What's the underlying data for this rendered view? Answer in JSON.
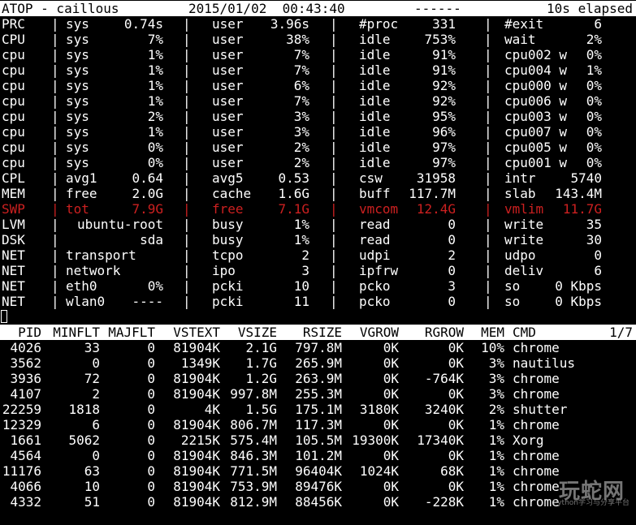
{
  "header": {
    "title": "ATOP - caillous",
    "datetime": "2015/01/02  00:43:40",
    "dashes": "------",
    "elapsed": "10s elapsed"
  },
  "system_rows": [
    {
      "label": "PRC",
      "c1k": "sys",
      "c1v": "0.74s",
      "c2k": "user",
      "c2v": "3.96s",
      "c3k": "#proc",
      "c3v": "331",
      "c4k": "#exit",
      "c4v": "6"
    },
    {
      "label": "CPU",
      "c1k": "sys",
      "c1v": "7%",
      "c2k": "user",
      "c2v": "38%",
      "c3k": "idle",
      "c3v": "753%",
      "c4k": "wait",
      "c4v": "2%"
    },
    {
      "label": "cpu",
      "c1k": "sys",
      "c1v": "1%",
      "c2k": "user",
      "c2v": "7%",
      "c3k": "idle",
      "c3v": "91%",
      "c4k": "cpu002 w",
      "c4v": "0%"
    },
    {
      "label": "cpu",
      "c1k": "sys",
      "c1v": "1%",
      "c2k": "user",
      "c2v": "7%",
      "c3k": "idle",
      "c3v": "91%",
      "c4k": "cpu004 w",
      "c4v": "1%"
    },
    {
      "label": "cpu",
      "c1k": "sys",
      "c1v": "1%",
      "c2k": "user",
      "c2v": "6%",
      "c3k": "idle",
      "c3v": "92%",
      "c4k": "cpu000 w",
      "c4v": "0%"
    },
    {
      "label": "cpu",
      "c1k": "sys",
      "c1v": "1%",
      "c2k": "user",
      "c2v": "7%",
      "c3k": "idle",
      "c3v": "92%",
      "c4k": "cpu006 w",
      "c4v": "0%"
    },
    {
      "label": "cpu",
      "c1k": "sys",
      "c1v": "2%",
      "c2k": "user",
      "c2v": "3%",
      "c3k": "idle",
      "c3v": "95%",
      "c4k": "cpu003 w",
      "c4v": "0%"
    },
    {
      "label": "cpu",
      "c1k": "sys",
      "c1v": "1%",
      "c2k": "user",
      "c2v": "3%",
      "c3k": "idle",
      "c3v": "96%",
      "c4k": "cpu007 w",
      "c4v": "0%"
    },
    {
      "label": "cpu",
      "c1k": "sys",
      "c1v": "0%",
      "c2k": "user",
      "c2v": "2%",
      "c3k": "idle",
      "c3v": "97%",
      "c4k": "cpu005 w",
      "c4v": "0%"
    },
    {
      "label": "cpu",
      "c1k": "sys",
      "c1v": "0%",
      "c2k": "user",
      "c2v": "2%",
      "c3k": "idle",
      "c3v": "97%",
      "c4k": "cpu001 w",
      "c4v": "0%"
    },
    {
      "label": "CPL",
      "c1k": "avg1",
      "c1v": "0.64",
      "c2k": "avg5",
      "c2v": "0.53",
      "c3k": "csw",
      "c3v": "31958",
      "c4k": "intr",
      "c4v": "5740"
    },
    {
      "label": "MEM",
      "c1k": "free",
      "c1v": "2.0G",
      "c2k": "cache",
      "c2v": "1.6G",
      "c3k": "buff",
      "c3v": "117.7M",
      "c4k": "slab",
      "c4v": "143.4M"
    },
    {
      "label": "SWP",
      "c1k": "tot",
      "c1v": "7.9G",
      "c2k": "free",
      "c2v": "7.1G",
      "c3k": "vmcom",
      "c3v": "12.4G",
      "c4k": "vmlim",
      "c4v": "11.7G"
    },
    {
      "label": "LVM",
      "c1k": "",
      "c1v": "ubuntu-root",
      "c2k": "busy",
      "c2v": "1%",
      "c3k": "read",
      "c3v": "0",
      "c4k": "write",
      "c4v": "35"
    },
    {
      "label": "DSK",
      "c1k": "",
      "c1v": "sda",
      "c2k": "busy",
      "c2v": "1%",
      "c3k": "read",
      "c3v": "0",
      "c4k": "write",
      "c4v": "30"
    },
    {
      "label": "NET",
      "c1k": "transport",
      "c1v": "",
      "c2k": "tcpo",
      "c2v": "2",
      "c3k": "udpi",
      "c3v": "2",
      "c4k": "udpo",
      "c4v": "0"
    },
    {
      "label": "NET",
      "c1k": "network",
      "c1v": "",
      "c2k": "ipo",
      "c2v": "3",
      "c3k": "ipfrw",
      "c3v": "0",
      "c4k": "deliv",
      "c4v": "6"
    },
    {
      "label": "NET",
      "c1k": "eth0",
      "c1v": "0%",
      "c2k": "pcki",
      "c2v": "10",
      "c3k": "pcko",
      "c3v": "3",
      "c4k": "so",
      "c4v": "0 Kbps"
    },
    {
      "label": "NET",
      "c1k": "wlan0",
      "c1v": "----",
      "c2k": "pcki",
      "c2v": "11",
      "c3k": "pcko",
      "c3v": "0",
      "c4k": "so",
      "c4v": "0 Kbps"
    }
  ],
  "separator": "|",
  "process_header": {
    "pid": "PID",
    "minflt": "MINFLT",
    "majflt": "MAJFLT",
    "vstext": "VSTEXT",
    "vsize": "VSIZE",
    "rsize": "RSIZE",
    "vgrow": "VGROW",
    "rgrow": "RGROW",
    "mem": "MEM",
    "cmd": "CMD",
    "page": "1/7"
  },
  "processes": [
    {
      "pid": "4026",
      "minflt": "33",
      "majflt": "0",
      "vstext": "81904K",
      "vsize": "2.1G",
      "rsize": "797.8M",
      "vgrow": "0K",
      "rgrow": "0K",
      "mem": "10%",
      "cmd": "chrome"
    },
    {
      "pid": "3562",
      "minflt": "0",
      "majflt": "0",
      "vstext": "1349K",
      "vsize": "1.7G",
      "rsize": "265.9M",
      "vgrow": "0K",
      "rgrow": "0K",
      "mem": "3%",
      "cmd": "nautilus"
    },
    {
      "pid": "3936",
      "minflt": "72",
      "majflt": "0",
      "vstext": "81904K",
      "vsize": "1.2G",
      "rsize": "263.9M",
      "vgrow": "0K",
      "rgrow": "-764K",
      "mem": "3%",
      "cmd": "chrome"
    },
    {
      "pid": "4107",
      "minflt": "2",
      "majflt": "0",
      "vstext": "81904K",
      "vsize": "997.8M",
      "rsize": "255.3M",
      "vgrow": "0K",
      "rgrow": "0K",
      "mem": "3%",
      "cmd": "chrome"
    },
    {
      "pid": "22259",
      "minflt": "1818",
      "majflt": "0",
      "vstext": "4K",
      "vsize": "1.5G",
      "rsize": "175.1M",
      "vgrow": "3180K",
      "rgrow": "3240K",
      "mem": "2%",
      "cmd": "shutter"
    },
    {
      "pid": "12329",
      "minflt": "6",
      "majflt": "0",
      "vstext": "81904K",
      "vsize": "806.7M",
      "rsize": "117.3M",
      "vgrow": "0K",
      "rgrow": "0K",
      "mem": "1%",
      "cmd": "chrome"
    },
    {
      "pid": "1661",
      "minflt": "5062",
      "majflt": "0",
      "vstext": "2215K",
      "vsize": "575.4M",
      "rsize": "105.5M",
      "vgrow": "19300K",
      "rgrow": "17340K",
      "mem": "1%",
      "cmd": "Xorg"
    },
    {
      "pid": "4564",
      "minflt": "0",
      "majflt": "0",
      "vstext": "81904K",
      "vsize": "846.3M",
      "rsize": "101.2M",
      "vgrow": "0K",
      "rgrow": "0K",
      "mem": "1%",
      "cmd": "chrome"
    },
    {
      "pid": "11176",
      "minflt": "63",
      "majflt": "0",
      "vstext": "81904K",
      "vsize": "771.5M",
      "rsize": "96404K",
      "vgrow": "1024K",
      "rgrow": "68K",
      "mem": "1%",
      "cmd": "chrome"
    },
    {
      "pid": "4066",
      "minflt": "10",
      "majflt": "0",
      "vstext": "81904K",
      "vsize": "753.9M",
      "rsize": "89476K",
      "vgrow": "0K",
      "rgrow": "0K",
      "mem": "1%",
      "cmd": "chrome"
    },
    {
      "pid": "4332",
      "minflt": "51",
      "majflt": "0",
      "vstext": "81904K",
      "vsize": "812.9M",
      "rsize": "88456K",
      "vgrow": "0K",
      "rgrow": "-228K",
      "mem": "1%",
      "cmd": "chrome"
    }
  ],
  "watermark": {
    "logo": "玩蛇网",
    "sub": "Python学习与分享平台"
  }
}
